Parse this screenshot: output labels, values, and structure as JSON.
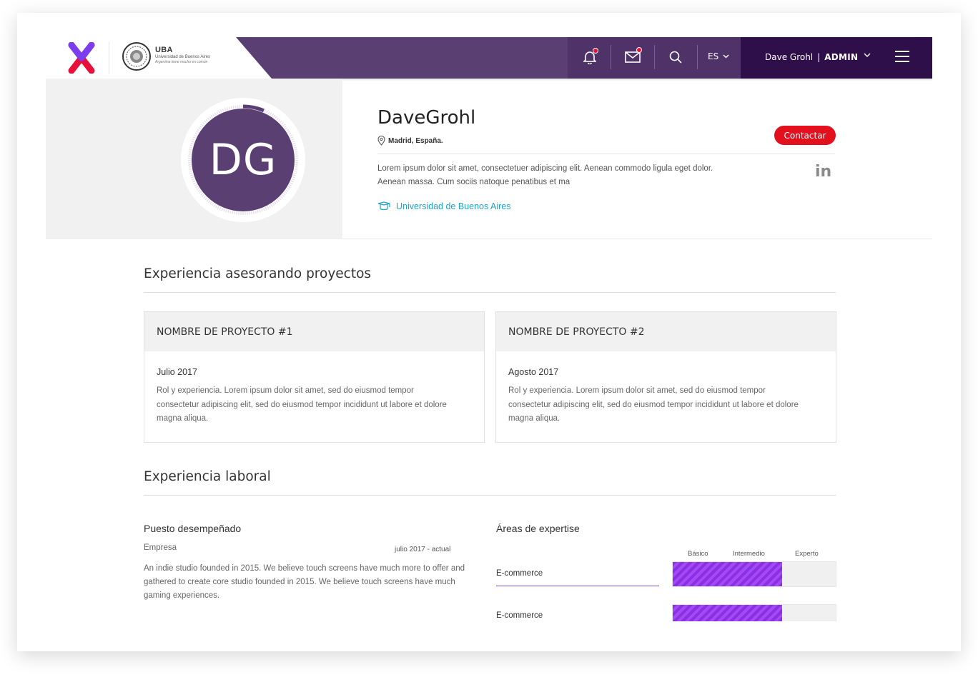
{
  "nav": {
    "uba_acronym": "UBA",
    "uba_name": "Universidad de Buenos Aires",
    "uba_motto": "Argentina tiene mucho en común",
    "language": "ES",
    "user_name": "Dave Grohl",
    "user_separator": "|",
    "user_role": "ADMIN"
  },
  "profile": {
    "initials": "DG",
    "name": "DaveGrohl",
    "location": "Madrid, España.",
    "contact_label": "Contactar",
    "bio": "Lorem ipsum dolor sit amet, consectetuer adipiscing elit. Aenean commodo ligula eget dolor. Aenean massa. Cum sociis natoque penatibus et ma",
    "linkedin": "in",
    "university": "Universidad de Buenos Aires",
    "accent_color": "#5a3f73",
    "link_color": "#1aa5c6"
  },
  "projects": {
    "title": "Experiencia asesorando proyectos",
    "items": [
      {
        "name": "NOMBRE DE PROYECTO #1",
        "date": "Julio 2017",
        "description": "Rol y experiencia. Lorem ipsum dolor sit amet, sed do eiusmod tempor consectetur adipiscing elit, sed do eiusmod tempor incididunt ut labore et dolore magna aliqua."
      },
      {
        "name": "NOMBRE DE PROYECTO #2",
        "date": "Agosto 2017",
        "description": "Rol y experiencia. Lorem ipsum dolor sit amet, sed do eiusmod tempor consectetur adipiscing elit, sed do eiusmod tempor incididunt ut labore et dolore magna aliqua."
      }
    ]
  },
  "work": {
    "title": "Experiencia laboral",
    "job_title": "Puesto desempeñado",
    "company": "Empresa",
    "period": "julio 2017 - actual",
    "description": "An indie studio founded in 2015. We believe touch screens have much more to offer and gathered to create core studio founded in 2015. We believe touch screens have much gaming experiences."
  },
  "expertise": {
    "title": "Áreas de expertise",
    "levels": [
      "Básico",
      "Intermedio",
      "Experto"
    ],
    "skills": [
      {
        "name": "E-commerce",
        "level_fraction": 0.67
      },
      {
        "name": "E-commerce",
        "level_fraction": 0.67
      }
    ],
    "bar_color": "#8b2ee6"
  }
}
